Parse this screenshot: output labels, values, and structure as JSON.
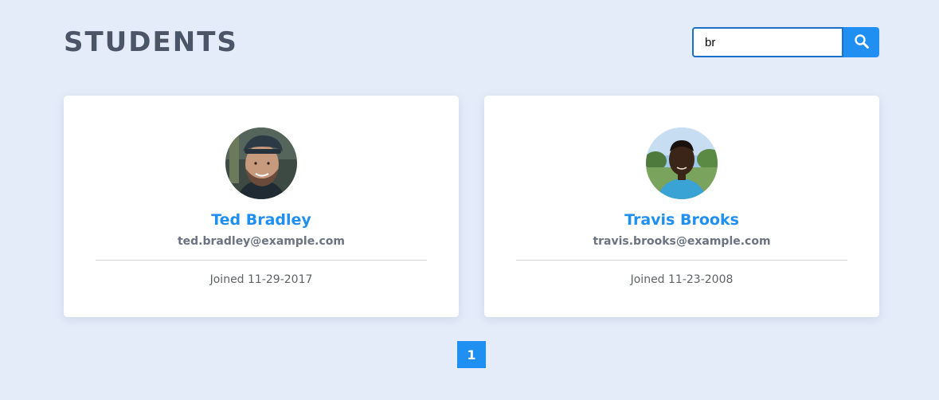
{
  "header": {
    "title": "STUDENTS"
  },
  "search": {
    "value": "br",
    "button_icon": "search-icon"
  },
  "students": [
    {
      "name": "Ted Bradley",
      "email": "ted.bradley@example.com",
      "joined": "Joined 11-29-2017"
    },
    {
      "name": "Travis Brooks",
      "email": "travis.brooks@example.com",
      "joined": "Joined 11-23-2008"
    }
  ],
  "pagination": {
    "pages": [
      "1"
    ],
    "active": "1"
  },
  "colors": {
    "background": "#e5ecf9",
    "accent": "#1f8ff2",
    "title": "#4a5568"
  }
}
